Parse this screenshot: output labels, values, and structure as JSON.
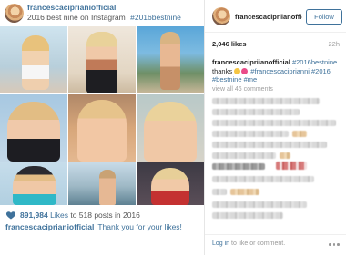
{
  "post": {
    "username": "francescaciprianiofficial",
    "caption": "2016 best nine on Instagram",
    "hashtag": "#2016bestnine",
    "stats": {
      "likes_count": "891,984",
      "likes_word": "Likes",
      "posts_phrase": "to 518 posts in 2016"
    },
    "thanks": "Thank you for your likes!"
  },
  "sidebar": {
    "username": "francescacipriianofficial",
    "follow_label": "Follow",
    "likes": "2,046 likes",
    "age": "22h",
    "caption_user": "francescacipriianofficial",
    "caption_tag": "#2016bestnine",
    "caption_thanks": "thanks",
    "caption_tags2": "#francescaciprianni #2016",
    "caption_tag3": "#bestnine #me",
    "view_all": "view all 46 comments",
    "login_link": "Log in",
    "login_rest": "to like or comment."
  },
  "icons": {
    "heart": "heart-icon",
    "more": "more-options-icon"
  },
  "colors": {
    "link": "#3f729b",
    "text": "#262626",
    "muted": "#a0a0a0"
  }
}
